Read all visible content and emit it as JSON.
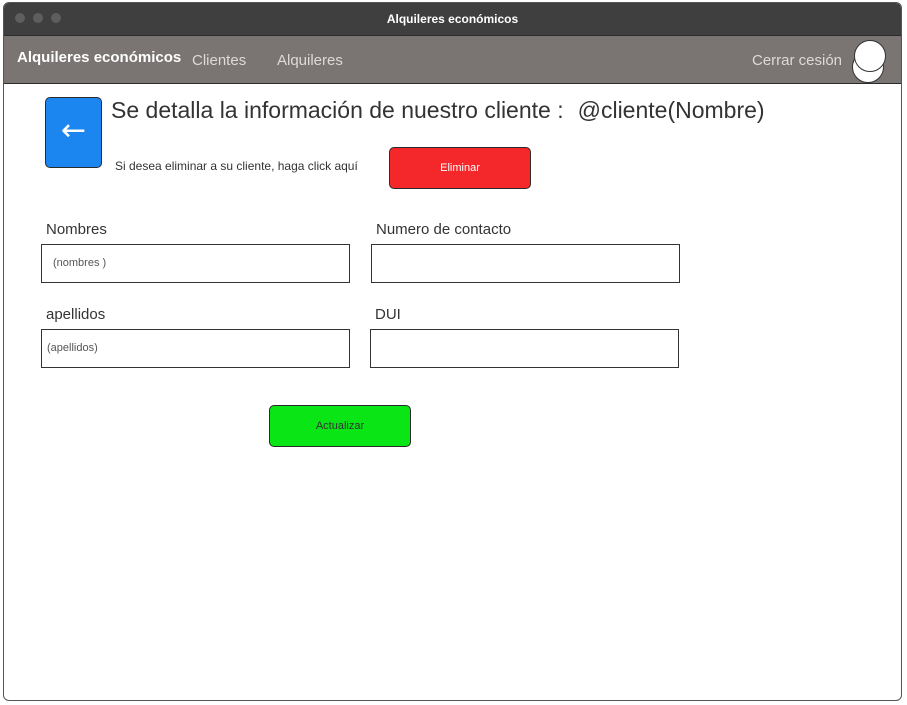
{
  "window": {
    "title": "Alquileres económicos"
  },
  "navbar": {
    "brand": "Alquileres económicos",
    "links": [
      "Clientes",
      "Alquileres"
    ],
    "logout": "Cerrar cesión",
    "avatar_icon": "user-avatar-icon"
  },
  "header": {
    "back_icon": "arrow-left-icon",
    "back_glyph": "←",
    "title": "Se detalla la información de nuestro cliente :",
    "client_var": "@cliente(Nombre)",
    "delete_hint": "Si desea eliminar a su cliente, haga click aquí",
    "delete_label": "Eliminar"
  },
  "form": {
    "nombres": {
      "label": "Nombres",
      "value": "(nombres )"
    },
    "contacto": {
      "label": "Numero de contacto",
      "value": ""
    },
    "apellidos": {
      "label": "apellidos",
      "value": "(apellidos)"
    },
    "dui": {
      "label": "DUI",
      "value": ""
    },
    "update_label": "Actualizar"
  },
  "colors": {
    "titlebar": "#3f3f3f",
    "navbar": "#7a7472",
    "back_button": "#1b86f0",
    "delete_button": "#f4282b",
    "update_button": "#09e515"
  }
}
